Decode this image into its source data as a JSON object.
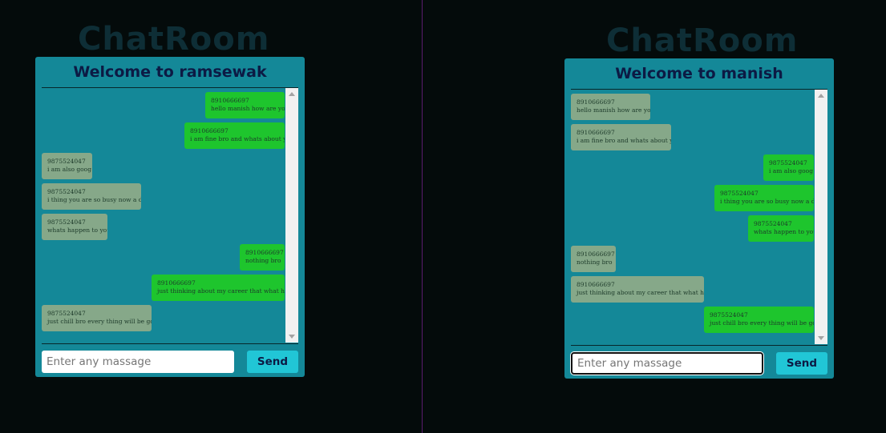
{
  "app_title": "ChatRoom",
  "placeholder": "Enter any massage",
  "send_label": "Send",
  "colors": {
    "background": "#040b0b",
    "panel": "#148898",
    "sent_bubble": "#1ec52d",
    "received_bubble": "#86a889",
    "send_button": "#21c6d6"
  },
  "windows": [
    {
      "welcome": "Welcome to ramsewak",
      "messages": [
        {
          "from": "8910666697",
          "text": "hello manish how are you",
          "side": "sent"
        },
        {
          "from": "8910666697",
          "text": "i am fine bro and whats about you",
          "side": "sent"
        },
        {
          "from": "9875524047",
          "text": "i am also goog",
          "side": "received"
        },
        {
          "from": "9875524047",
          "text": "i thing you are so busy now a day",
          "side": "received"
        },
        {
          "from": "9875524047",
          "text": "whats happen to you",
          "side": "received"
        },
        {
          "from": "8910666697",
          "text": "nothing bro",
          "side": "sent"
        },
        {
          "from": "8910666697",
          "text": "just thinking about my career that what happen",
          "side": "sent"
        },
        {
          "from": "9875524047",
          "text": "just chill bro every thing will be goog",
          "side": "received"
        }
      ]
    },
    {
      "welcome": "Welcome to manish",
      "messages": [
        {
          "from": "8910666697",
          "text": "hello manish how are you",
          "side": "received"
        },
        {
          "from": "8910666697",
          "text": "i am fine bro and whats about you",
          "side": "received"
        },
        {
          "from": "9875524047",
          "text": "i am also goog",
          "side": "sent"
        },
        {
          "from": "9875524047",
          "text": "i thing you are so busy now a day",
          "side": "sent"
        },
        {
          "from": "9875524047",
          "text": "whats happen to you",
          "side": "sent"
        },
        {
          "from": "8910666697",
          "text": "nothing bro",
          "side": "received"
        },
        {
          "from": "8910666697",
          "text": "just thinking about my career that what happen",
          "side": "received"
        },
        {
          "from": "9875524047",
          "text": "just chill bro every thing will be goog",
          "side": "sent"
        }
      ]
    }
  ]
}
